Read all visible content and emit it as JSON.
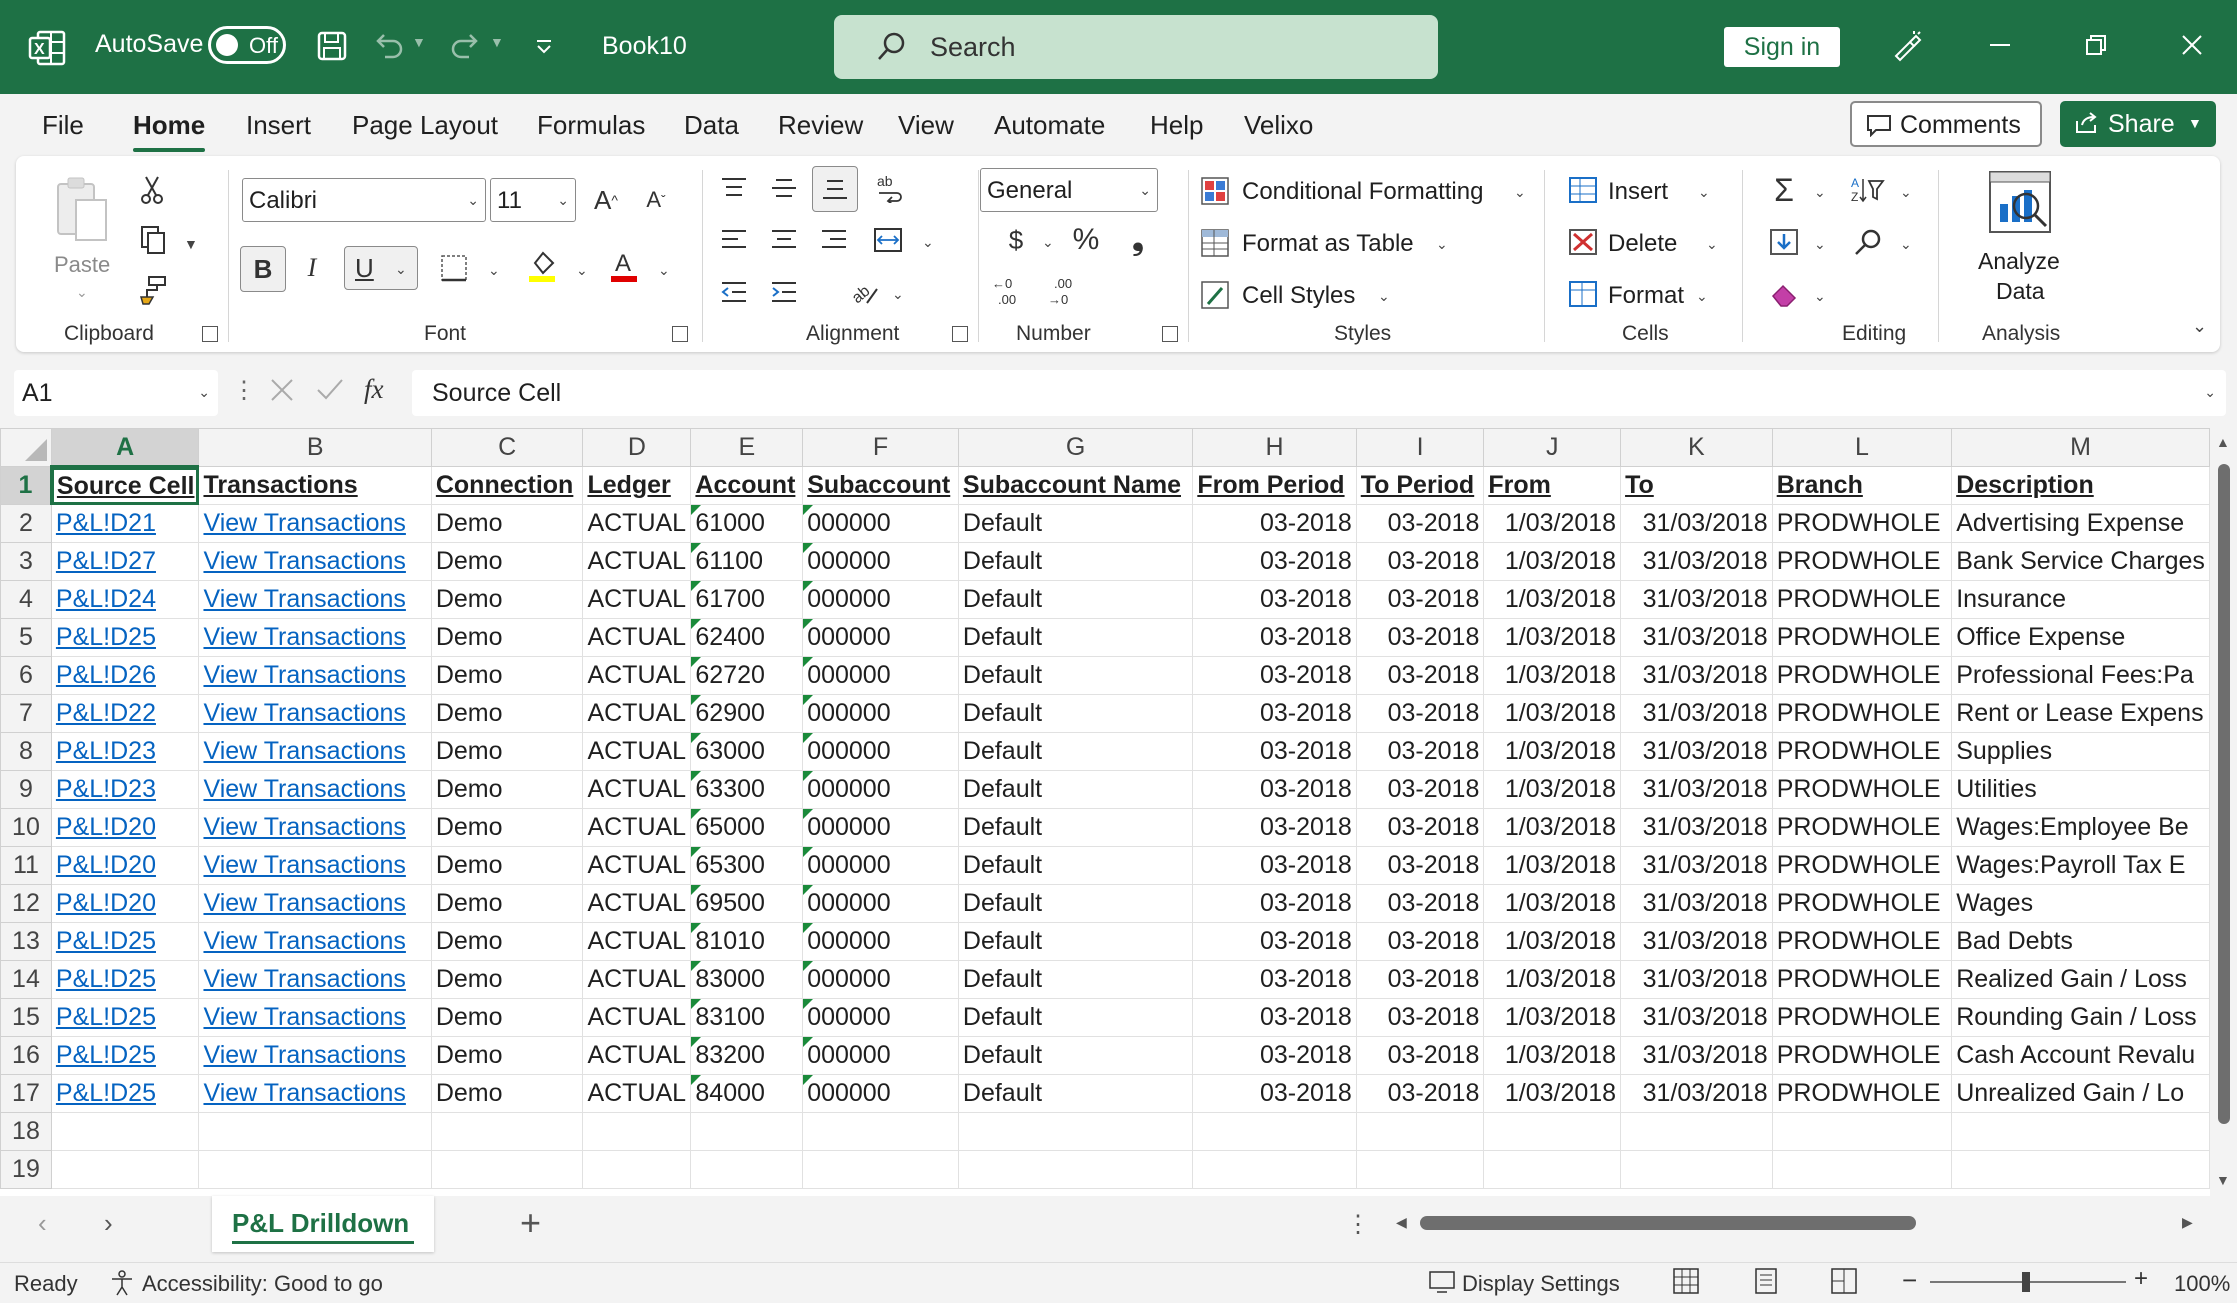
{
  "titlebar": {
    "autosave_label": "AutoSave",
    "autosave_state": "Off",
    "book_title": "Book10",
    "search_placeholder": "Search",
    "signin_label": "Sign in"
  },
  "menu": {
    "tabs": [
      "File",
      "Home",
      "Insert",
      "Page Layout",
      "Formulas",
      "Data",
      "Review",
      "View",
      "Automate",
      "Help",
      "Velixo"
    ],
    "active_tab": "Home",
    "comments_label": "Comments",
    "share_label": "Share"
  },
  "ribbon": {
    "clipboard": {
      "paste_label": "Paste",
      "group_label": "Clipboard"
    },
    "font": {
      "font_name": "Calibri",
      "font_size": "11",
      "group_label": "Font",
      "bold": "B",
      "italic": "I",
      "underline": "U"
    },
    "alignment": {
      "group_label": "Alignment"
    },
    "number": {
      "format": "General",
      "group_label": "Number",
      "currency": "$",
      "percent": "%",
      "comma": "❟"
    },
    "styles": {
      "conditional_formatting": "Conditional Formatting",
      "format_as_table": "Format as Table",
      "cell_styles": "Cell Styles",
      "group_label": "Styles"
    },
    "cells": {
      "insert": "Insert",
      "delete": "Delete",
      "format": "Format",
      "group_label": "Cells"
    },
    "editing": {
      "group_label": "Editing"
    },
    "analysis": {
      "analyze_line1": "Analyze",
      "analyze_line2": "Data",
      "group_label": "Analysis"
    }
  },
  "formula_bar": {
    "name_box": "A1",
    "fx": "fx",
    "content": "Source Cell"
  },
  "sheet": {
    "columns": [
      "A",
      "B",
      "C",
      "D",
      "E",
      "F",
      "G",
      "H",
      "I",
      "J",
      "K",
      "L",
      "M"
    ],
    "headers": [
      "Source Cell",
      "Transactions",
      "Connection",
      "Ledger",
      "Account",
      "Subaccount",
      "Subaccount Name",
      "From Period",
      "To Period",
      "From",
      "To",
      "Branch",
      "Description"
    ],
    "rows": [
      [
        "P&L!D21",
        "View Transactions",
        "Demo",
        "ACTUAL",
        "61000",
        "000000",
        "Default",
        "03-2018",
        "03-2018",
        "1/03/2018",
        "31/03/2018",
        "PRODWHOLE",
        "Advertising Expense"
      ],
      [
        "P&L!D27",
        "View Transactions",
        "Demo",
        "ACTUAL",
        "61100",
        "000000",
        "Default",
        "03-2018",
        "03-2018",
        "1/03/2018",
        "31/03/2018",
        "PRODWHOLE",
        "Bank Service Charges"
      ],
      [
        "P&L!D24",
        "View Transactions",
        "Demo",
        "ACTUAL",
        "61700",
        "000000",
        "Default",
        "03-2018",
        "03-2018",
        "1/03/2018",
        "31/03/2018",
        "PRODWHOLE",
        "Insurance"
      ],
      [
        "P&L!D25",
        "View Transactions",
        "Demo",
        "ACTUAL",
        "62400",
        "000000",
        "Default",
        "03-2018",
        "03-2018",
        "1/03/2018",
        "31/03/2018",
        "PRODWHOLE",
        "Office Expense"
      ],
      [
        "P&L!D26",
        "View Transactions",
        "Demo",
        "ACTUAL",
        "62720",
        "000000",
        "Default",
        "03-2018",
        "03-2018",
        "1/03/2018",
        "31/03/2018",
        "PRODWHOLE",
        "Professional Fees:Pa"
      ],
      [
        "P&L!D22",
        "View Transactions",
        "Demo",
        "ACTUAL",
        "62900",
        "000000",
        "Default",
        "03-2018",
        "03-2018",
        "1/03/2018",
        "31/03/2018",
        "PRODWHOLE",
        "Rent or Lease Expens"
      ],
      [
        "P&L!D23",
        "View Transactions",
        "Demo",
        "ACTUAL",
        "63000",
        "000000",
        "Default",
        "03-2018",
        "03-2018",
        "1/03/2018",
        "31/03/2018",
        "PRODWHOLE",
        "Supplies"
      ],
      [
        "P&L!D23",
        "View Transactions",
        "Demo",
        "ACTUAL",
        "63300",
        "000000",
        "Default",
        "03-2018",
        "03-2018",
        "1/03/2018",
        "31/03/2018",
        "PRODWHOLE",
        "Utilities"
      ],
      [
        "P&L!D20",
        "View Transactions",
        "Demo",
        "ACTUAL",
        "65000",
        "000000",
        "Default",
        "03-2018",
        "03-2018",
        "1/03/2018",
        "31/03/2018",
        "PRODWHOLE",
        "Wages:Employee Be"
      ],
      [
        "P&L!D20",
        "View Transactions",
        "Demo",
        "ACTUAL",
        "65300",
        "000000",
        "Default",
        "03-2018",
        "03-2018",
        "1/03/2018",
        "31/03/2018",
        "PRODWHOLE",
        "Wages:Payroll Tax E"
      ],
      [
        "P&L!D20",
        "View Transactions",
        "Demo",
        "ACTUAL",
        "69500",
        "000000",
        "Default",
        "03-2018",
        "03-2018",
        "1/03/2018",
        "31/03/2018",
        "PRODWHOLE",
        "Wages"
      ],
      [
        "P&L!D25",
        "View Transactions",
        "Demo",
        "ACTUAL",
        "81010",
        "000000",
        "Default",
        "03-2018",
        "03-2018",
        "1/03/2018",
        "31/03/2018",
        "PRODWHOLE",
        "Bad Debts"
      ],
      [
        "P&L!D25",
        "View Transactions",
        "Demo",
        "ACTUAL",
        "83000",
        "000000",
        "Default",
        "03-2018",
        "03-2018",
        "1/03/2018",
        "31/03/2018",
        "PRODWHOLE",
        "Realized Gain / Loss"
      ],
      [
        "P&L!D25",
        "View Transactions",
        "Demo",
        "ACTUAL",
        "83100",
        "000000",
        "Default",
        "03-2018",
        "03-2018",
        "1/03/2018",
        "31/03/2018",
        "PRODWHOLE",
        "Rounding Gain / Loss"
      ],
      [
        "P&L!D25",
        "View Transactions",
        "Demo",
        "ACTUAL",
        "83200",
        "000000",
        "Default",
        "03-2018",
        "03-2018",
        "1/03/2018",
        "31/03/2018",
        "PRODWHOLE",
        "Cash Account Revalu"
      ],
      [
        "P&L!D25",
        "View Transactions",
        "Demo",
        "ACTUAL",
        "84000",
        "000000",
        "Default",
        "03-2018",
        "03-2018",
        "1/03/2018",
        "31/03/2018",
        "PRODWHOLE",
        "Unrealized Gain / Lo"
      ]
    ],
    "extra_rows": [
      "18",
      "19"
    ]
  },
  "sheet_tabs": {
    "active": "P&L Drilldown",
    "add_label": "+"
  },
  "status": {
    "ready": "Ready",
    "accessibility": "Accessibility: Good to go",
    "display_settings": "Display Settings",
    "zoom": "100%"
  },
  "colors": {
    "brand": "#1e7145",
    "link": "#0563c1",
    "search_bg": "#c7e2cf"
  }
}
